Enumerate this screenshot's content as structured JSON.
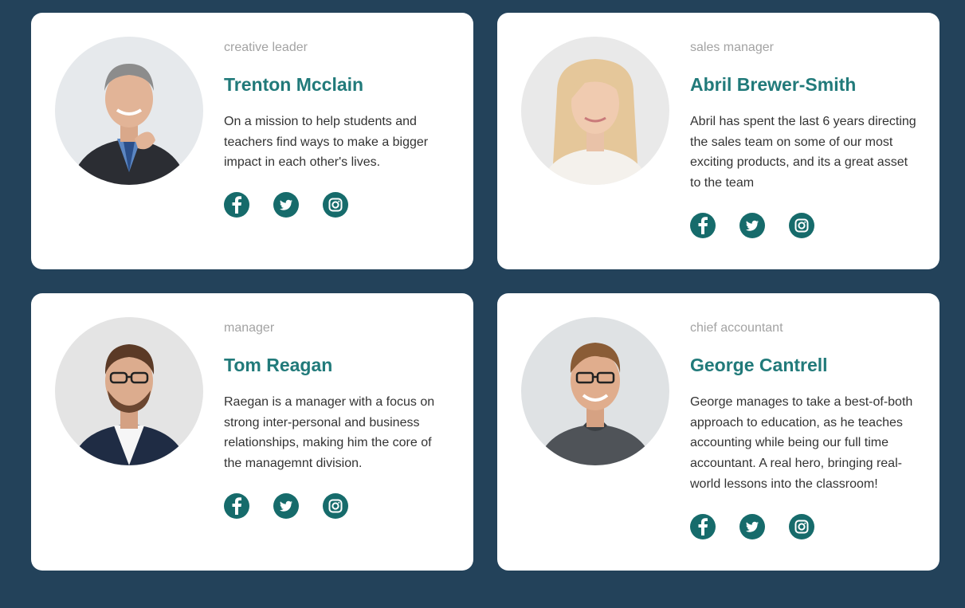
{
  "colors": {
    "page_background": "#23425a",
    "card_background": "#ffffff",
    "name_color": "#217a7a",
    "role_color": "#a3a3a3",
    "bio_color": "#333333",
    "social_icon_color": "#166b6b"
  },
  "team": [
    {
      "role": "creative leader",
      "name": "Trenton Mcclain",
      "bio": "On a mission to help students and teachers find ways to make a bigger impact in each other's lives.",
      "social_icons": [
        "facebook-icon",
        "twitter-icon",
        "instagram-icon"
      ]
    },
    {
      "role": "sales manager",
      "name": "Abril Brewer-Smith",
      "bio": "Abril has spent the last 6 years directing the sales team on some of our most exciting products, and its a great asset to the team",
      "social_icons": [
        "facebook-icon",
        "twitter-icon",
        "instagram-icon"
      ]
    },
    {
      "role": "manager",
      "name": "Tom Reagan",
      "bio": "Raegan is a manager with a focus on strong inter-personal and business relationships, making him the core of the managemnt division.",
      "social_icons": [
        "facebook-icon",
        "twitter-icon",
        "instagram-icon"
      ]
    },
    {
      "role": "chief accountant",
      "name": "George Cantrell",
      "bio": "George manages to take a best-of-both approach to education, as he teaches accounting while being our full time accountant. A real hero, bringing real-world lessons into the classroom!",
      "social_icons": [
        "facebook-icon",
        "twitter-icon",
        "instagram-icon"
      ]
    }
  ]
}
